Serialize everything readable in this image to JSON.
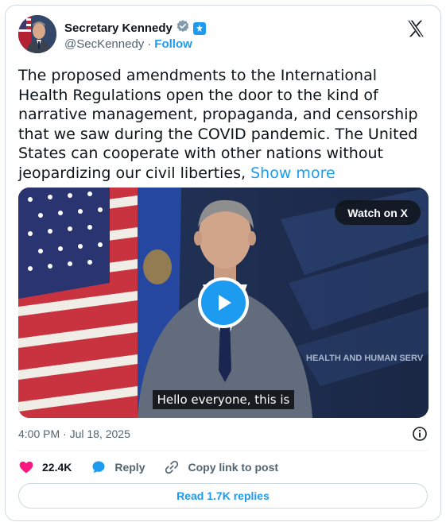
{
  "author": {
    "name": "Secretary Kennedy",
    "handle": "@SecKennedy",
    "separator": "·",
    "follow_label": "Follow"
  },
  "tweet": {
    "text": "The proposed amendments to the International Health Regulations open the door to the kind of narrative management, propaganda, and censorship that we saw during the COVID pandemic. The United States can cooperate with other nations without jeopardizing our civil liberties,",
    "show_more_label": "Show more",
    "timestamp": "4:00 PM · Jul 18, 2025"
  },
  "media": {
    "watch_label": "Watch on X",
    "caption": "Hello everyone, this is",
    "backdrop_text": "HEALTH AND HUMAN SERV"
  },
  "actions": {
    "likes": "22.4K",
    "reply_label": "Reply",
    "copy_label": "Copy link to post",
    "read_replies_label": "Read 1.7K replies"
  },
  "colors": {
    "accent": "#1d9bf0",
    "like": "#f91880",
    "text_primary": "#0f1419",
    "text_secondary": "#536471"
  }
}
